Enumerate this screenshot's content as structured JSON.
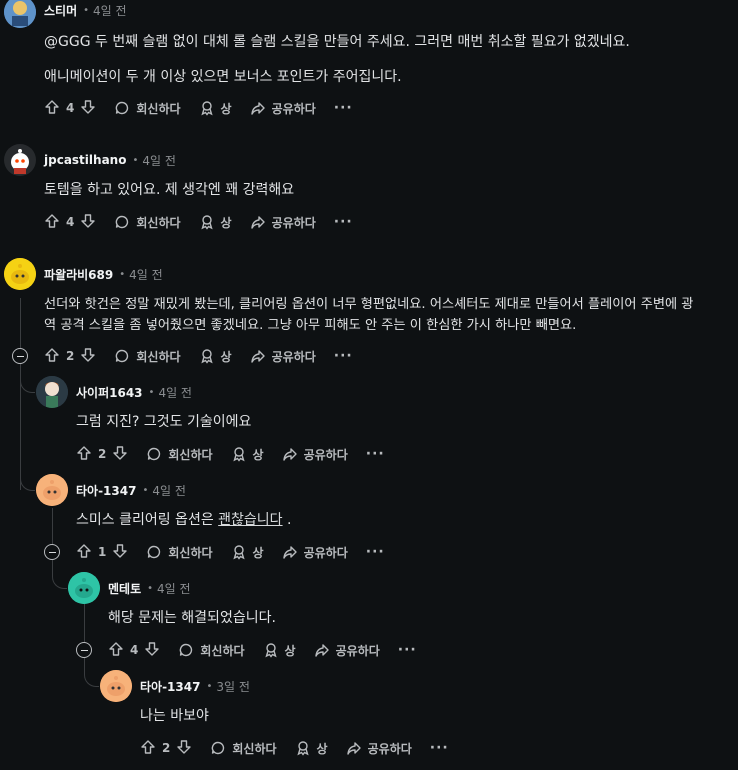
{
  "actions": {
    "reply": "회신하다",
    "award": "상",
    "share": "공유하다",
    "more": "···"
  },
  "comments": [
    {
      "author": "스티머",
      "time": "4일 전",
      "body1": "@GGG 두 번째 슬램 없이 대체 롤 슬램 스킬을 만들어 주세요. 그러면 매번 취소할 필요가 없겠네요.",
      "body2": "애니메이션이 두 개 이상 있으면 보너스 포인트가 주어집니다.",
      "score": "4"
    },
    {
      "author": "jpcastilhano",
      "time": "4일 전",
      "body": "토템을 하고 있어요. 제 생각엔 꽤 강력해요",
      "score": "4"
    },
    {
      "author": "파왈라비689",
      "time": "4일 전",
      "body1": "선더와 핫건은 정말 재밌게 봤는데, 클리어링 옵션이 너무 형편없네요. 어스셰터도 제대로 만들어서 플레이어 주변에 광",
      "body2": "역 공격 스킬을 좀 넣어줬으면 좋겠네요. 그냥 아무 피해도 안 주는 이 한심한 가시 하나만 빼면요.",
      "score": "2"
    },
    {
      "author": "사이퍼1643",
      "time": "4일 전",
      "body": "그럼 지진? 그것도 기술이에요",
      "score": "2"
    },
    {
      "author": "타아-1347",
      "time": "4일 전",
      "body_pre": "스미스 클리어링 옵션은 ",
      "body_link": "괜찮습니다",
      "body_post": " .",
      "score": "1"
    },
    {
      "author": "멘테토",
      "time": "4일 전",
      "body": "해당 문제는 해결되었습니다.",
      "score": "4"
    },
    {
      "author": "타아-1347",
      "time": "3일 전",
      "body": "나는 바보야",
      "score": "2"
    }
  ]
}
